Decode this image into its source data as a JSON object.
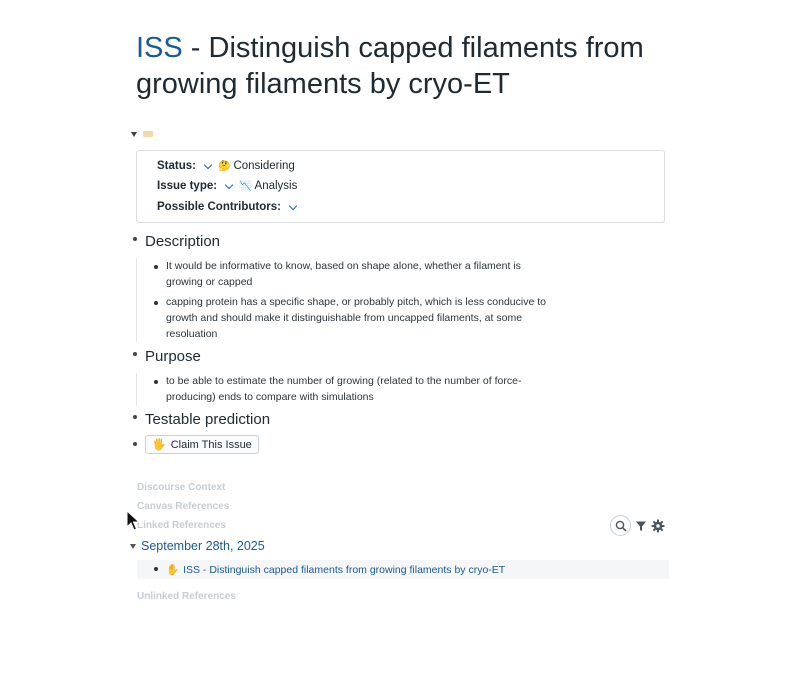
{
  "title": {
    "link": "ISS",
    "rest": " - Distinguish capped filaments from growing filaments by cryo-ET"
  },
  "properties": {
    "status_label": "Status:",
    "status_emoji": "🤔",
    "status_value": "Considering",
    "issue_type_label": "Issue type:",
    "issue_type_emoji": "📉",
    "issue_type_value": "Analysis",
    "contributors_label": "Possible Contributors:"
  },
  "sections": {
    "description": {
      "heading": "Description",
      "items": [
        "It would be informative to know, based on shape alone, whether a filament is growing or capped",
        "capping protein has a specific shape, or probably pitch, which is less conducive to growth and should make it distinguishable from uncapped filaments, at some resoluation"
      ]
    },
    "purpose": {
      "heading": "Purpose",
      "items": [
        "to be able to estimate the number of growing (related to the number of force-producing) ends to compare with simulations"
      ]
    },
    "prediction": {
      "heading": "Testable prediction"
    }
  },
  "claim_button": {
    "emoji": "🖐",
    "label": "Claim This Issue"
  },
  "references": {
    "discourse_context": "Discourse Context",
    "canvas_references": "Canvas References",
    "linked_references": "Linked References",
    "unlinked_references": "Unlinked References",
    "date": "September 28th, 2025",
    "item_emoji": "✋",
    "item_text": "ISS - Distinguish capped filaments from growing filaments by cryo-ET"
  },
  "colors": {
    "link": "#1a5a96",
    "faded_heading": "#c6cdd3",
    "chevron": "#2069b3"
  },
  "icons": [
    "search-icon",
    "filter-icon",
    "gear-icon",
    "cursor-icon"
  ]
}
